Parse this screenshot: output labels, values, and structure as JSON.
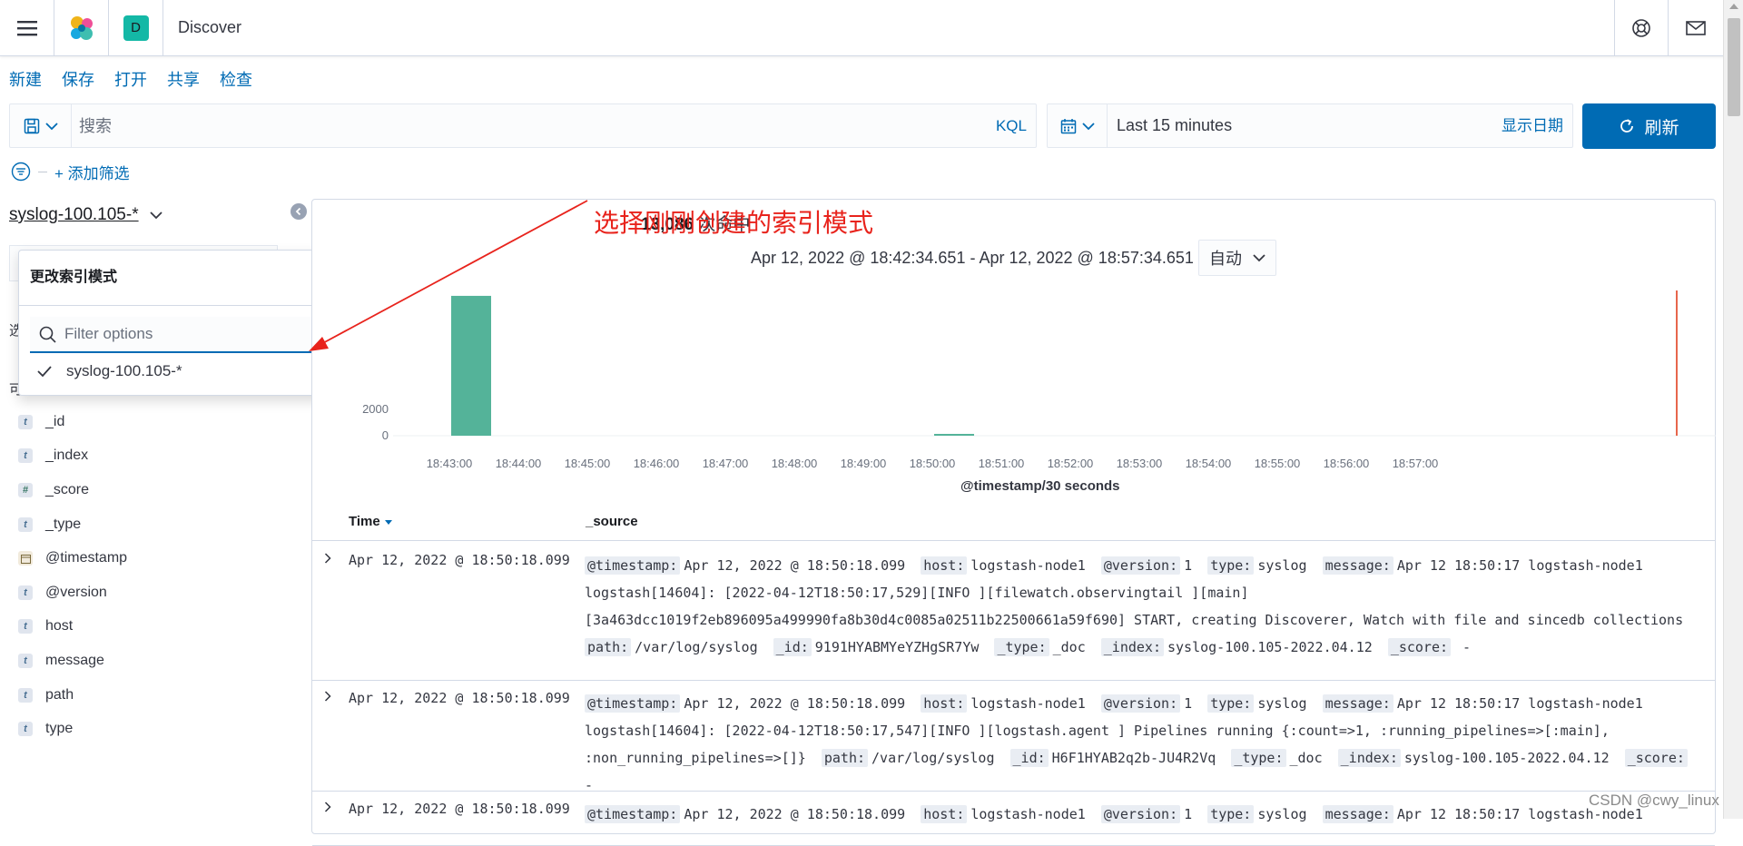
{
  "header": {
    "app_title": "Discover",
    "space_initial": "D"
  },
  "topnav": [
    "新建",
    "保存",
    "打开",
    "共享",
    "检查"
  ],
  "query": {
    "placeholder": "搜索",
    "language": "KQL"
  },
  "time_picker": {
    "range": "Last 15 minutes",
    "show_dates": "显示日期",
    "refresh": "刷新"
  },
  "filters": {
    "add_label": "+ 添加筛选"
  },
  "sidebar": {
    "index_pattern": "syslog-100.105-*",
    "selected_fields_frag": "选",
    "available_fields_frag": "可",
    "fields": [
      {
        "type": "t",
        "name": "_id"
      },
      {
        "type": "t",
        "name": "_index"
      },
      {
        "type": "#",
        "name": "_score"
      },
      {
        "type": "t",
        "name": "_type"
      },
      {
        "type": "date",
        "name": "@timestamp"
      },
      {
        "type": "t",
        "name": "@version"
      },
      {
        "type": "t",
        "name": "host"
      },
      {
        "type": "t",
        "name": "message"
      },
      {
        "type": "t",
        "name": "path"
      },
      {
        "type": "t",
        "name": "type"
      }
    ]
  },
  "popover": {
    "title": "更改索引模式",
    "filter_placeholder": "Filter options",
    "option": "syslog-100.105-*"
  },
  "annotation": "选择刚刚创建的索引模式",
  "hits": {
    "count": "13,086",
    "label": "次命中"
  },
  "time_range": "Apr 12, 2022 @ 18:42:34.651 - Apr 12, 2022 @ 18:57:34.651",
  "interval": "自动",
  "chart_data": {
    "type": "bar",
    "xlabel": "@timestamp/30 seconds",
    "x_ticks": [
      "18:43:00",
      "18:44:00",
      "18:45:00",
      "18:46:00",
      "18:47:00",
      "18:48:00",
      "18:49:00",
      "18:50:00",
      "18:51:00",
      "18:52:00",
      "18:53:00",
      "18:54:00",
      "18:55:00",
      "18:56:00",
      "18:57:00"
    ],
    "y_ticks": [
      "2000",
      "0"
    ],
    "bars": [
      {
        "x": "18:43:00",
        "value": 13000
      },
      {
        "x": "18:50:00",
        "value": 86
      }
    ],
    "ylim": [
      0,
      13500
    ],
    "bar_color": "#54b399",
    "now_marker_color": "#e7664c"
  },
  "table": {
    "col_time": "Time",
    "col_source": "_source",
    "rows": [
      {
        "time": "Apr 12, 2022 @ 18:50:18.099",
        "fields": [
          {
            "k": "@timestamp:",
            "v": "Apr 12, 2022 @ 18:50:18.099"
          },
          {
            "k": "host:",
            "v": "logstash-node1"
          },
          {
            "k": "@version:",
            "v": "1"
          },
          {
            "k": "type:",
            "v": "syslog"
          },
          {
            "k": "message:",
            "v": "Apr 12 18:50:17 logstash-node1 logstash[14604]: [2022-04-12T18:50:17,529][INFO ][filewatch.observingtail ][main] [3a463dcc1019f2eb896095a499990fa8b30d4c0085a02511b22500661a59f690] START, creating Discoverer, Watch with file and sincedb collections"
          },
          {
            "k": "path:",
            "v": "/var/log/syslog"
          },
          {
            "k": "_id:",
            "v": "9191HYABMYeYZHgSR7Yw"
          },
          {
            "k": "_type:",
            "v": "_doc"
          },
          {
            "k": "_index:",
            "v": "syslog-100.105-2022.04.12"
          },
          {
            "k": "_score:",
            "v": " -"
          }
        ]
      },
      {
        "time": "Apr 12, 2022 @ 18:50:18.099",
        "fields": [
          {
            "k": "@timestamp:",
            "v": "Apr 12, 2022 @ 18:50:18.099"
          },
          {
            "k": "host:",
            "v": "logstash-node1"
          },
          {
            "k": "@version:",
            "v": "1"
          },
          {
            "k": "type:",
            "v": "syslog"
          },
          {
            "k": "message:",
            "v": "Apr 12 18:50:17 logstash-node1 logstash[14604]: [2022-04-12T18:50:17,547][INFO ][logstash.agent ] Pipelines running {:count=>1, :running_pipelines=>[:main], :non_running_pipelines=>[]}"
          },
          {
            "k": "path:",
            "v": "/var/log/syslog"
          },
          {
            "k": "_id:",
            "v": "H6F1HYAB2q2b-JU4R2Vq"
          },
          {
            "k": "_type:",
            "v": "_doc"
          },
          {
            "k": "_index:",
            "v": "syslog-100.105-2022.04.12"
          },
          {
            "k": "_score:",
            "v": " -"
          }
        ]
      },
      {
        "time": "Apr 12, 2022 @ 18:50:18.099",
        "fields": [
          {
            "k": "@timestamp:",
            "v": "Apr 12, 2022 @ 18:50:18.099"
          },
          {
            "k": "host:",
            "v": "logstash-node1"
          },
          {
            "k": "@version:",
            "v": "1"
          },
          {
            "k": "type:",
            "v": "syslog"
          },
          {
            "k": "message:",
            "v": "Apr 12 18:50:17 logstash-node1"
          }
        ]
      }
    ]
  },
  "watermark": "CSDN @cwy_linux"
}
